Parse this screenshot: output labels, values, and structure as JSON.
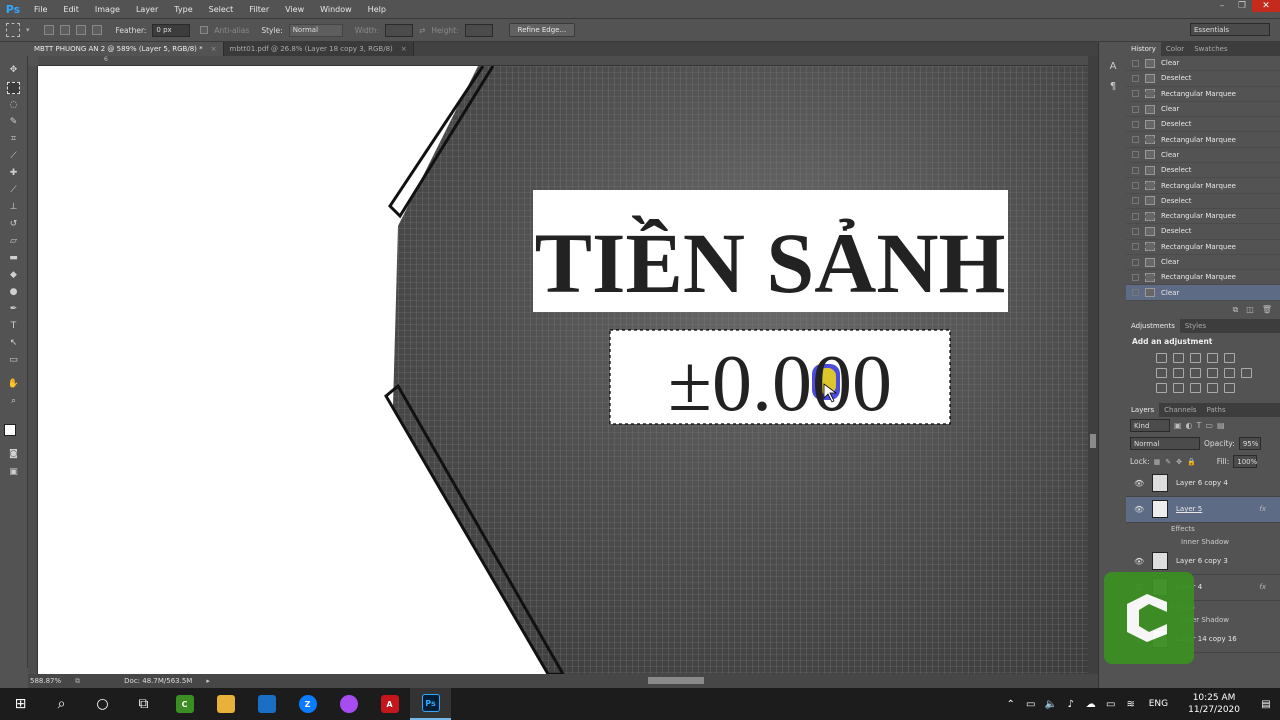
{
  "menu": {
    "logo": "Ps",
    "items": [
      "File",
      "Edit",
      "Image",
      "Layer",
      "Type",
      "Select",
      "Filter",
      "View",
      "Window",
      "Help"
    ]
  },
  "window_controls": {
    "min": "–",
    "restore": "❐",
    "close": "✕"
  },
  "options": {
    "feather_label": "Feather:",
    "feather_value": "0 px",
    "anti_alias_label": "Anti-alias",
    "style_label": "Style:",
    "style_value": "Normal",
    "width_label": "Width:",
    "height_label": "Height:",
    "refine_edge": "Refine Edge...",
    "workspace": "Essentials"
  },
  "tabs": [
    {
      "label": "MBTT PHUONG AN 2 @ 589% (Layer 5, RGB/8) *",
      "close": "×"
    },
    {
      "label": "mbtt01.pdf @ 26.8% (Layer 18 copy 3, RGB/8)",
      "close": "×"
    }
  ],
  "ruler": {
    "mark": "6"
  },
  "canvas": {
    "title_text": "TIỀN SẢNH",
    "level_text": "±0.000"
  },
  "status": {
    "zoom": "588.87%",
    "doc": "Doc: 48.7M/563.5M"
  },
  "history": {
    "tabs": [
      "History",
      "Color",
      "Swatches"
    ],
    "rows": [
      "Clear",
      "Deselect",
      "Rectangular Marquee",
      "Clear",
      "Deselect",
      "Rectangular Marquee",
      "Clear",
      "Deselect",
      "Rectangular Marquee",
      "Deselect",
      "Rectangular Marquee",
      "Deselect",
      "Rectangular Marquee",
      "Clear",
      "Rectangular Marquee",
      "Clear"
    ]
  },
  "adjustments": {
    "tabs": [
      "Adjustments",
      "Styles"
    ],
    "title": "Add an adjustment"
  },
  "layers": {
    "tabs": [
      "Layers",
      "Channels",
      "Paths"
    ],
    "kind": "Kind",
    "blend": "Normal",
    "opacity_label": "Opacity:",
    "opacity": "95%",
    "lock_label": "Lock:",
    "fill_label": "Fill:",
    "fill": "100%",
    "rows": [
      {
        "name": "Layer 6 copy 4",
        "fx": ""
      },
      {
        "name": "Layer 5",
        "fx": "fx"
      },
      {
        "name": "Layer 6 copy 3",
        "fx": ""
      },
      {
        "name": "Layer 4",
        "fx": "fx"
      },
      {
        "name": "Layer 14 copy 16",
        "fx": ""
      }
    ],
    "effects_label": "Effects",
    "inner_shadow": "Inner Shadow"
  },
  "tray": {
    "lang": "ENG",
    "time": "10:25 AM",
    "date": "11/27/2020"
  },
  "colors": {
    "accent": "#31a8ff",
    "selection": "#5e6b84",
    "camtasia": "#3b8f22"
  }
}
